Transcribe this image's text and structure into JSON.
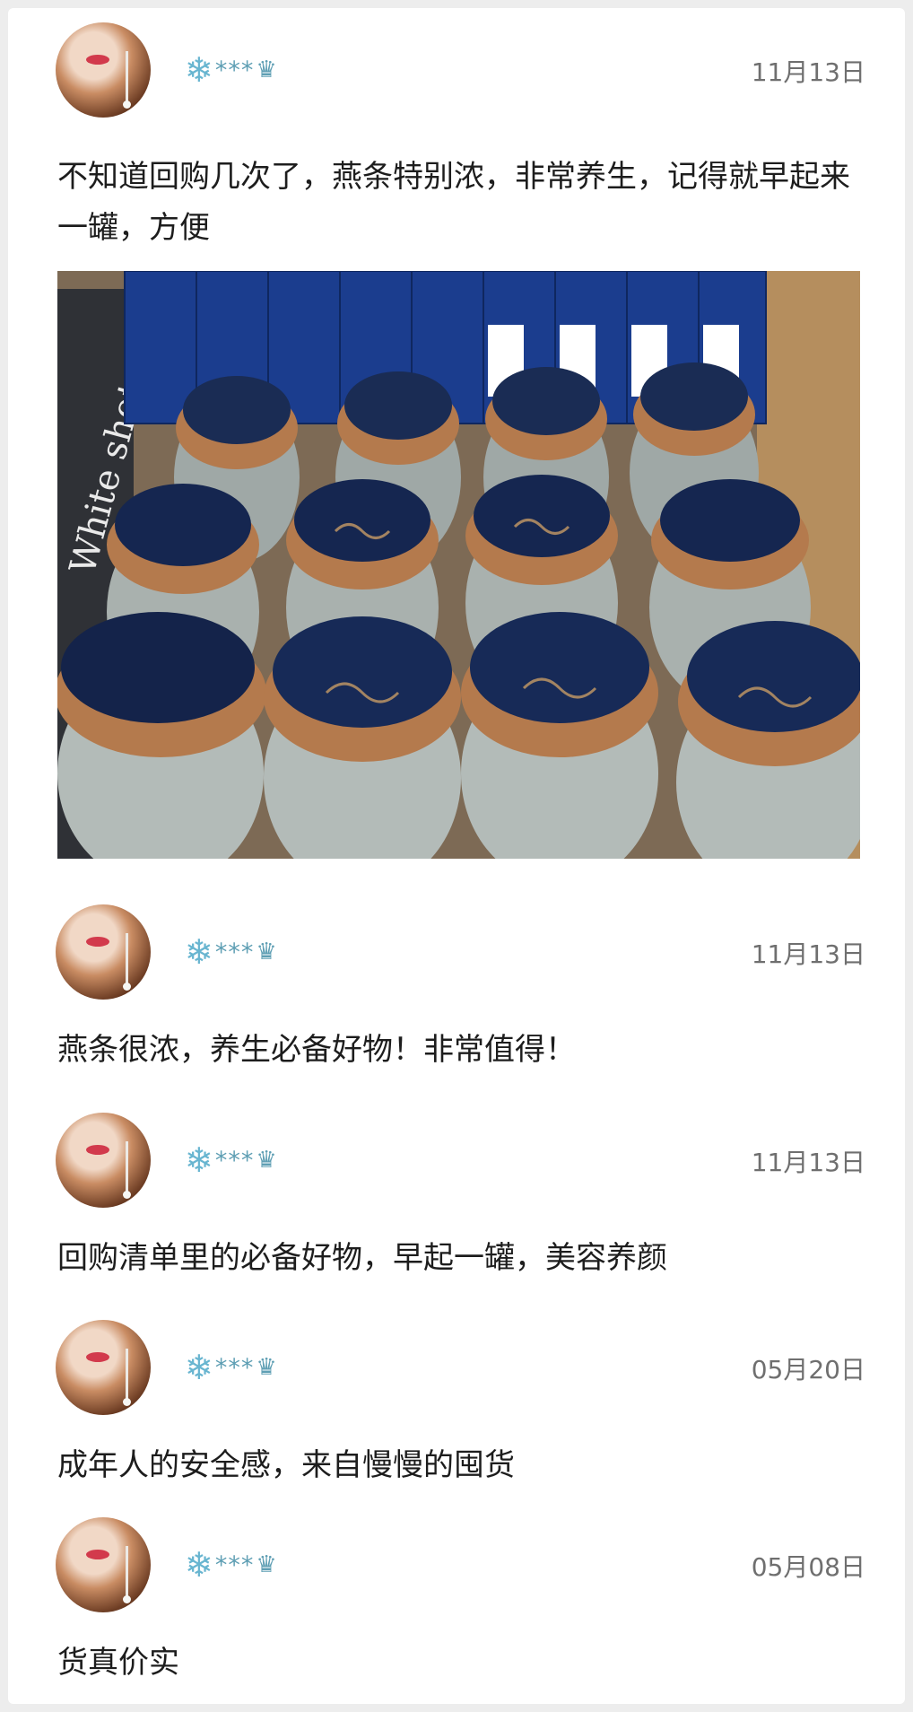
{
  "reviews": [
    {
      "username": "***",
      "date": "11月13日",
      "text": "不知道回购几次了，燕条特别浓，非常养生，记得就早起来一罐，方便",
      "has_photo": true
    },
    {
      "username": "***",
      "date": "11月13日",
      "text": "燕条很浓，养生必备好物！非常值得！"
    },
    {
      "username": "***",
      "date": "11月13日",
      "text": "回购清单里的必备好物，早起一罐，美容养颜"
    },
    {
      "username": "***",
      "date": "05月20日",
      "text": "成年人的安全感，来自慢慢的囤货"
    },
    {
      "username": "***",
      "date": "05月08日",
      "text": "货真价实"
    }
  ],
  "icons": {
    "prefix": "snowflake-icon",
    "suffix": "crown-icon"
  },
  "photo_label": "White shot"
}
